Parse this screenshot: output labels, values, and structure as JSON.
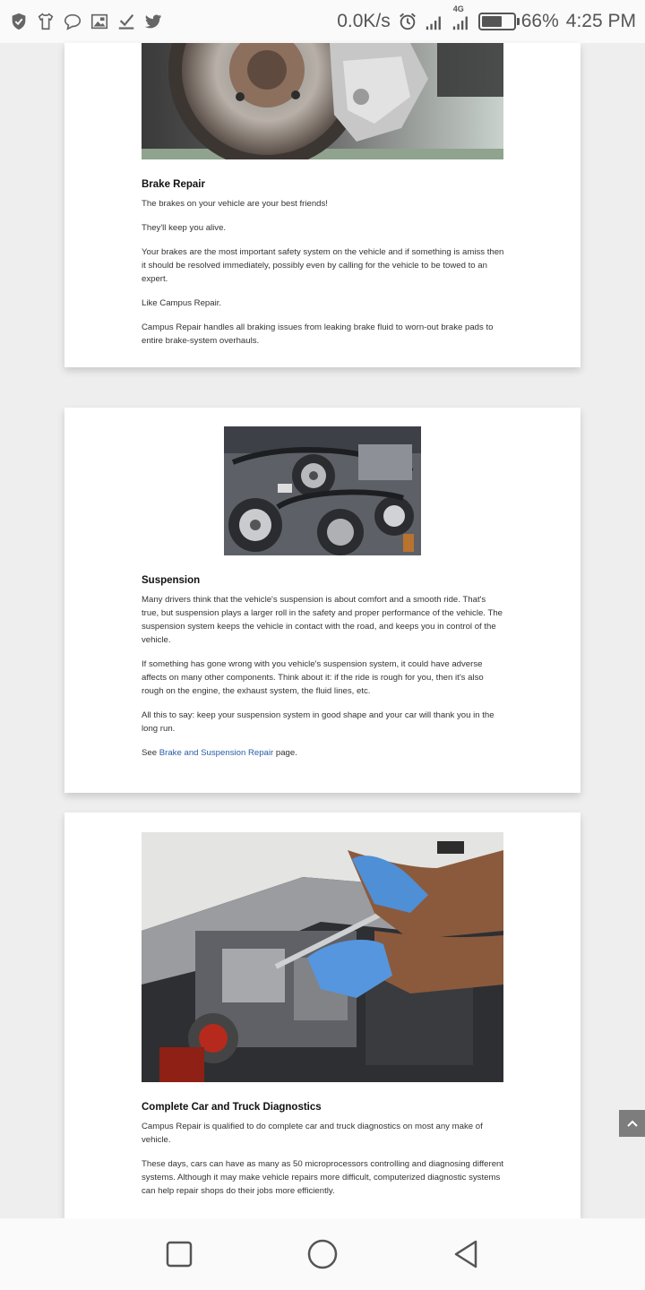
{
  "status_bar": {
    "net_speed": "0.0K/s",
    "network_type": "4G",
    "battery_percent": "66%",
    "battery_level": 0.66,
    "time": "4:25 PM",
    "icons": [
      "shield-check-icon",
      "tshirt-icon",
      "chat-bubble-icon",
      "gallery-icon",
      "download-check-icon",
      "twitter-icon",
      "alarm-icon",
      "signal-icon",
      "signal-4g-icon",
      "battery-icon"
    ]
  },
  "cards": [
    {
      "image": "brake-disc-photo",
      "title": "Brake Repair",
      "paragraphs": [
        "The brakes on your vehicle are your best friends!",
        "They'll keep you alive.",
        "Your brakes are the most important safety system on the vehicle and if something is amiss then it should be resolved immediately, possibly even by calling for the vehicle to be towed to an expert.",
        "Like Campus Repair.",
        "Campus Repair handles all braking issues from leaking brake fluid to worn-out brake pads to entire brake-system overhauls."
      ]
    },
    {
      "image": "engine-belts-photo",
      "title": "Suspension",
      "paragraphs": [
        "Many drivers think that the vehicle's suspension is about comfort and a smooth ride. That's true, but suspension plays a larger roll in the safety and proper performance of the vehicle. The suspension system keeps the vehicle in contact with the road, and keeps you in control of the vehicle.",
        "If something has gone wrong with you vehicle's suspension system, it could have adverse affects on many other components. Think about it: if the ride is rough for you, then it's also rough on the engine, the exhaust system, the fluid lines, etc.",
        "All this to say: keep your suspension system in good shape and your car will thank you in the long run."
      ],
      "see_prefix": "See",
      "see_link": "Brake and Suspension Repair",
      "see_suffix": "page."
    },
    {
      "image": "mechanic-engine-photo",
      "title": "Complete Car and Truck Diagnostics",
      "paragraphs": [
        "Campus Repair is qualified to do complete car and truck diagnostics on most any make of vehicle.",
        "These days, cars can have as many as 50 microprocessors controlling and diagnosing different systems. Although it may make vehicle repairs more difficult, computerized diagnostic systems can help repair shops do their jobs more efficiently."
      ]
    }
  ],
  "scroll_top": {
    "icon": "chevron-up-icon"
  },
  "nav_bar": {
    "icons": [
      "recents-square-icon",
      "home-circle-icon",
      "back-triangle-icon"
    ]
  }
}
